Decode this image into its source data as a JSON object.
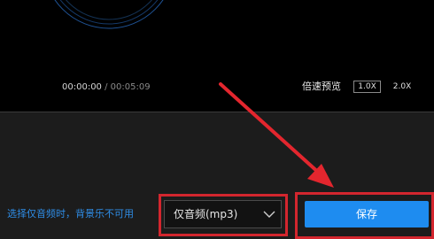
{
  "player": {
    "current_time": "00:00:00",
    "separator": "/",
    "total_time": "00:05:09",
    "speed_label": "倍速预览",
    "speed_options": [
      "1.0X",
      "2.0X"
    ],
    "selected_speed": "1.0X"
  },
  "export": {
    "note": "选择仅音频时，背景乐不可用",
    "format_select": "仅音频(mp3)",
    "save_label": "保存"
  },
  "colors": {
    "accent": "#1e8cf0",
    "note_text": "#2f8de6",
    "highlight": "#d3262e",
    "waveform": "#2f7fe6"
  },
  "icons": {
    "dropdown": "chevron-down-icon"
  }
}
